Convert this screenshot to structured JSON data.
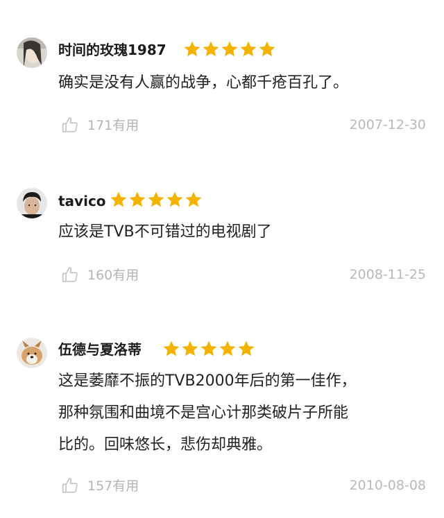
{
  "accent_star_color": "#f5b301",
  "reviews": [
    {
      "username": "时间的玫瑰1987",
      "rating": 5,
      "comment_lines": [
        "确实是没有人赢的战争，心都千疮百孔了。"
      ],
      "useful": "171有用",
      "date": "2007-12-30",
      "icon": "thumbs-up-icon"
    },
    {
      "username": "tavico",
      "rating": 5,
      "comment_lines": [
        "应该是TVB不可错过的电视剧了"
      ],
      "useful": "160有用",
      "date": "2008-11-25",
      "icon": "thumbs-up-icon"
    },
    {
      "username": "伍德与夏洛蒂",
      "rating": 5,
      "comment_lines": [
        "这是萎靡不振的TVB2000年后的第一佳作，",
        "那种氛围和曲境不是宫心计那类破片子所能",
        "比的。回味悠长，悲伤却典雅。"
      ],
      "useful": "157有用",
      "date": "2010-08-08",
      "icon": "thumbs-up-icon"
    }
  ]
}
